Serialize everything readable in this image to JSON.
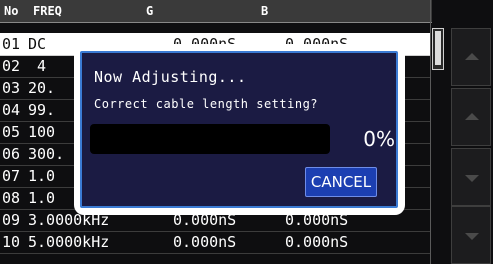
{
  "header": {
    "no": "No",
    "freq": "FREQ",
    "g": "G",
    "b": "B"
  },
  "rows": [
    {
      "no": "01",
      "freq": "DC",
      "g": "0.000nS",
      "b": "0.000nS"
    },
    {
      "no": "02",
      "freq": "4"
    },
    {
      "no": "03",
      "freq": "20."
    },
    {
      "no": "04",
      "freq": "99."
    },
    {
      "no": "05",
      "freq": "100"
    },
    {
      "no": "06",
      "freq": "300."
    },
    {
      "no": "07",
      "freq": "1.0"
    },
    {
      "no": "08",
      "freq": "1.0"
    },
    {
      "no": "09",
      "freq": "3.0000kHz",
      "g": "0.000nS",
      "b": "0.000nS"
    },
    {
      "no": "10",
      "freq": "5.0000kHz",
      "g": "0.000nS",
      "b": "0.000nS"
    }
  ],
  "dialog": {
    "title": "Now Adjusting...",
    "message": "Correct cable length setting?",
    "progress_percent": 0,
    "progress_label": "0%",
    "cancel_label": "CANCEL"
  },
  "side_buttons": [
    {
      "icon": "up-arrow-icon"
    },
    {
      "icon": "up-arrow-icon"
    },
    {
      "icon": "down-arrow-icon"
    },
    {
      "icon": "down-arrow-icon"
    }
  ]
}
